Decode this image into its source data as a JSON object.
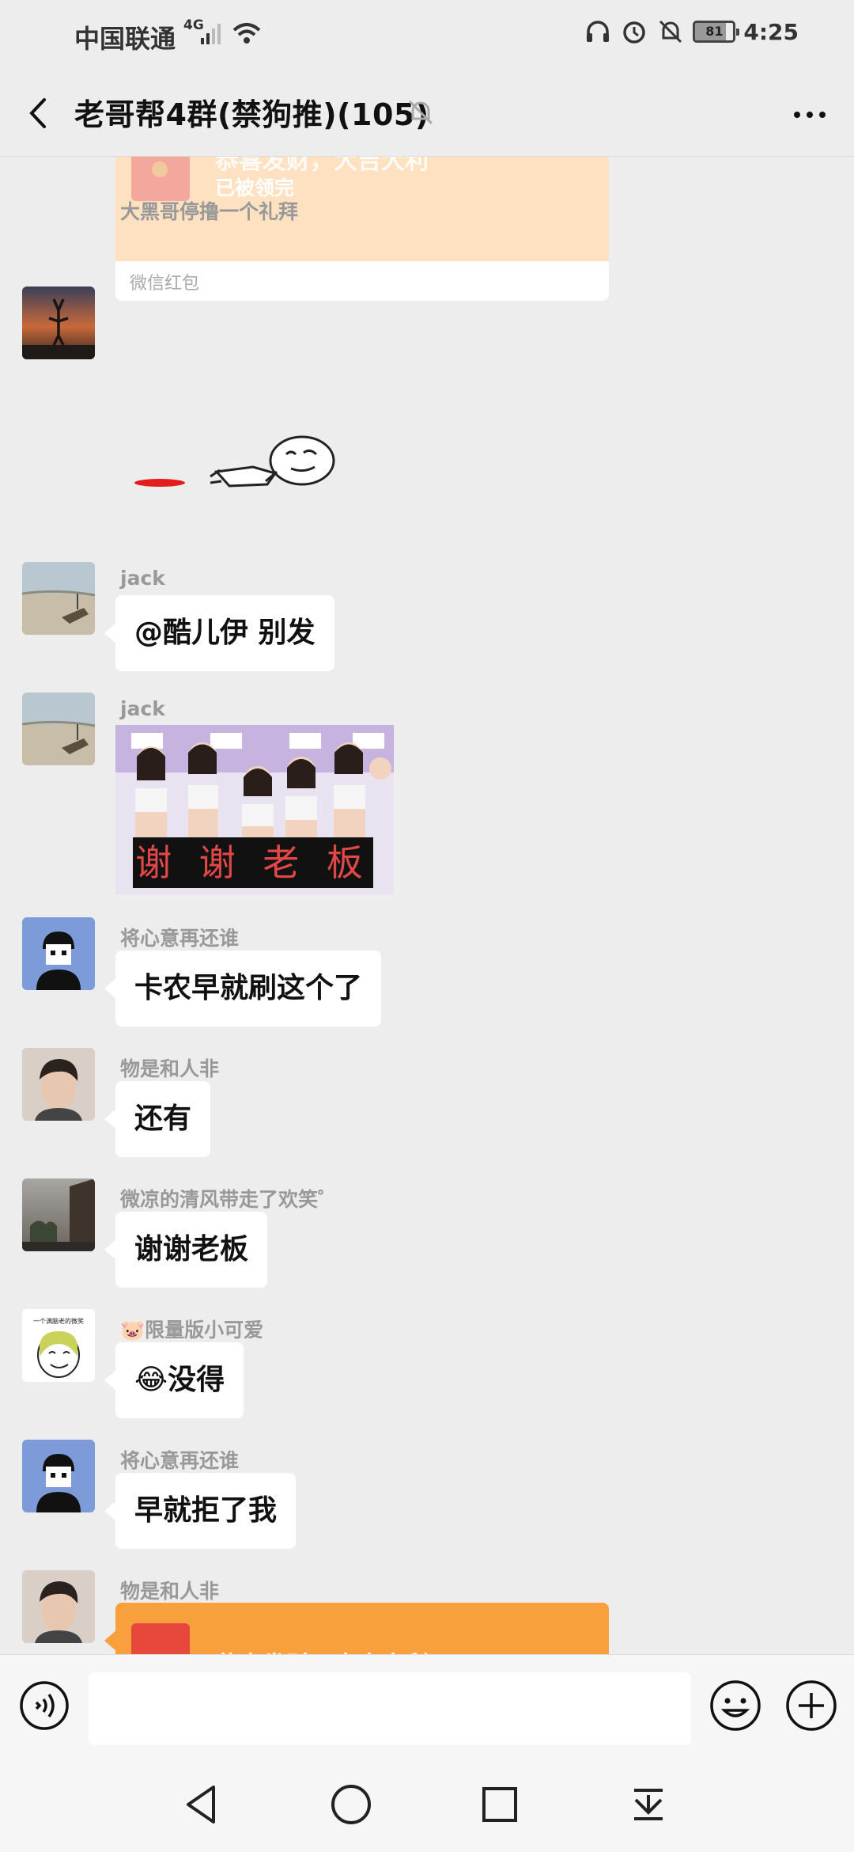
{
  "status_bar": {
    "carrier": "中国联通",
    "network": "4G",
    "battery": "81",
    "time": "4:25"
  },
  "header": {
    "title": "老哥帮4群(禁狗推)(105)"
  },
  "messages": {
    "red_packet_top": {
      "title": "恭喜发财，大吉大利",
      "status": "已被领完",
      "label": "微信红包"
    },
    "m1": {
      "sender": "大黑哥停撸一个礼拜"
    },
    "m2": {
      "sender": "jack",
      "text": "@酷儿伊  别发"
    },
    "m3": {
      "sender": "jack",
      "caption": "谢 谢 老 板"
    },
    "m4": {
      "sender": "将心意再还谁",
      "text": "卡农早就刷这个了"
    },
    "m5": {
      "sender": "物是和人非",
      "text": "还有"
    },
    "m6": {
      "sender": "微凉的清风带走了欢笑゜",
      "text": "谢谢老板"
    },
    "m7": {
      "sender": "🐷限量版小可爱",
      "text": "😂没得",
      "avatar_caption": "一个满脑老的微笑"
    },
    "m8": {
      "sender": "将心意再还谁",
      "text": "早就拒了我"
    },
    "m9": {
      "sender": "物是和人非",
      "card_title": "恭喜发财，大吉大利"
    }
  },
  "input": {
    "placeholder": ""
  },
  "colors": {
    "background": "#ededed",
    "bubble": "#ffffff",
    "red_packet_opened": "#fde1c1",
    "red_packet_new": "#f8a03d"
  }
}
